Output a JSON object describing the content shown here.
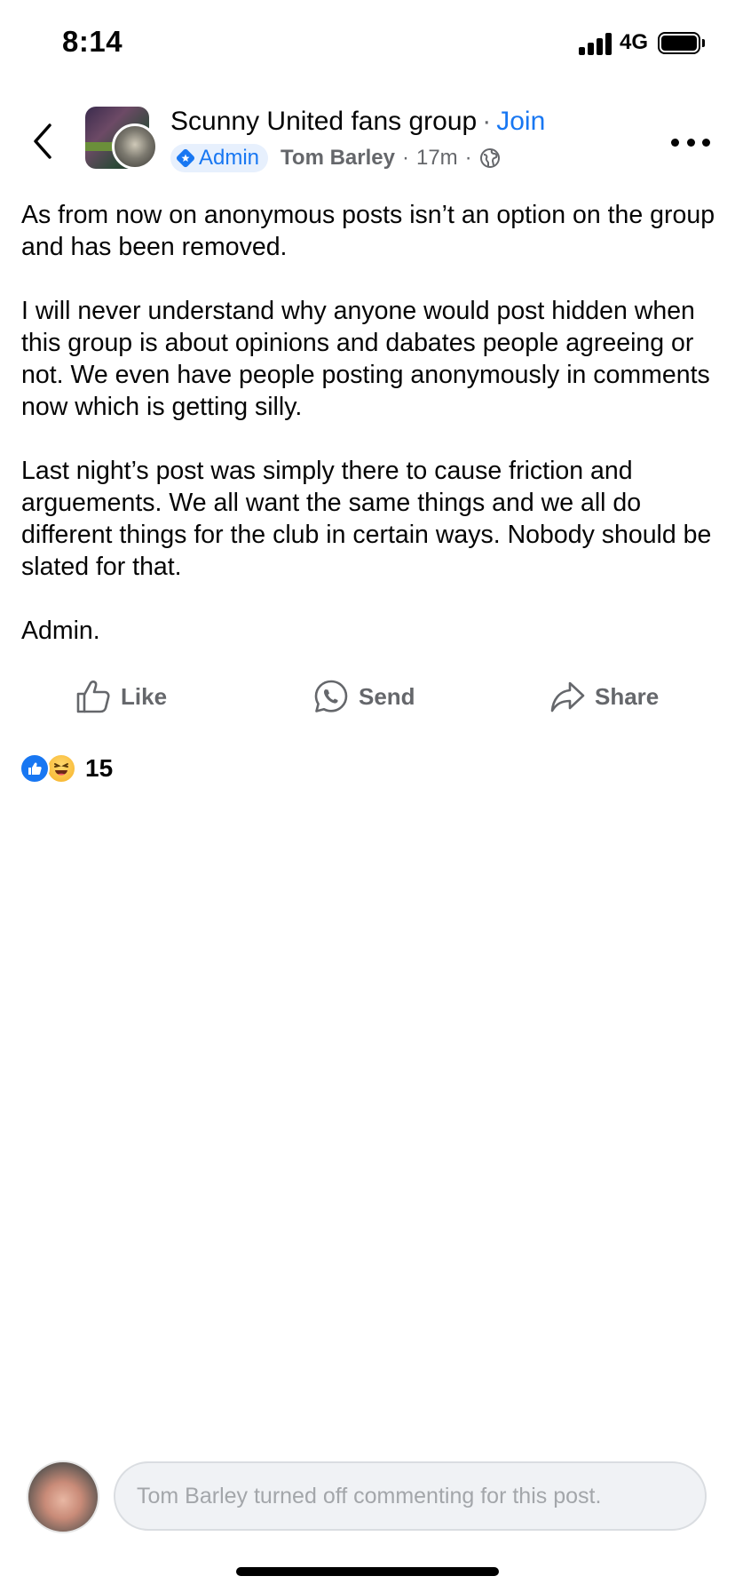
{
  "status_bar": {
    "time": "8:14",
    "network": "4G"
  },
  "header": {
    "group_name": "Scunny United fans group",
    "separator": "·",
    "join_label": "Join",
    "admin_badge": "Admin",
    "author": "Tom Barley",
    "time_ago": "17m",
    "meta_dot": "·",
    "privacy_icon": "globe-icon"
  },
  "post": {
    "paragraphs": [
      "As from now on anonymous posts isn’t an option on the group and has been removed.",
      "I will never understand why anyone would post hidden when this group is about opinions and dabates people agreeing or not. We even have people posting anonymously in comments now which is getting silly.",
      "Last night’s post was simply there to cause friction and arguements. We all want the same things and we all do different things for the club in certain ways. Nobody should be slated for that.",
      "Admin."
    ]
  },
  "actions": {
    "like": "Like",
    "send": "Send",
    "share": "Share"
  },
  "reactions": {
    "types": [
      "like",
      "haha"
    ],
    "count": "15"
  },
  "comment_bar": {
    "placeholder": "Tom Barley turned off commenting for this post."
  },
  "colors": {
    "accent": "#1877f2",
    "secondary_text": "#65676b",
    "primary_text": "#050505"
  }
}
